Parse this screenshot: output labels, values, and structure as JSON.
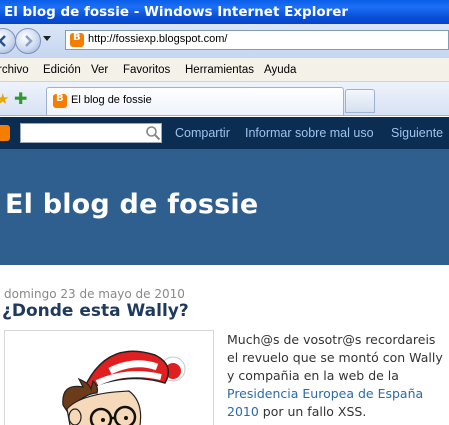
{
  "window": {
    "title": "El blog de fossie - Windows Internet Explorer"
  },
  "address_bar": {
    "url": "http://fossiexp.blogspot.com/"
  },
  "menu": {
    "items": [
      "rchivo",
      "Edición",
      "Ver",
      "Favoritos",
      "Herramientas",
      "Ayuda"
    ]
  },
  "tabs": [
    {
      "label": "El blog de fossie"
    }
  ],
  "navbar": {
    "links": [
      "Compartir",
      "Informar sobre mal uso",
      "Siguiente"
    ],
    "bg_color": "#0c2d52",
    "link_color": "#9fc3ef"
  },
  "blog": {
    "title": "El blog de fossie",
    "header_color": "#2f5f8f"
  },
  "post": {
    "date": "domingo 23 de mayo de 2010",
    "title": "¿Donde esta Wally?",
    "text_lines": [
      "Much@s de vosotr@s recordareis",
      "el revuelo que se montó con Wally",
      "y compañia en la web de la"
    ],
    "link_text_1": "Presidencia Europea de España",
    "link_text_2": "2010",
    "after_link": " por un fallo XSS."
  },
  "icons": [
    "back-arrow-icon",
    "forward-arrow-icon",
    "blogger-favicon",
    "favorites-star-icon",
    "add-favorite-icon",
    "search-icon"
  ]
}
